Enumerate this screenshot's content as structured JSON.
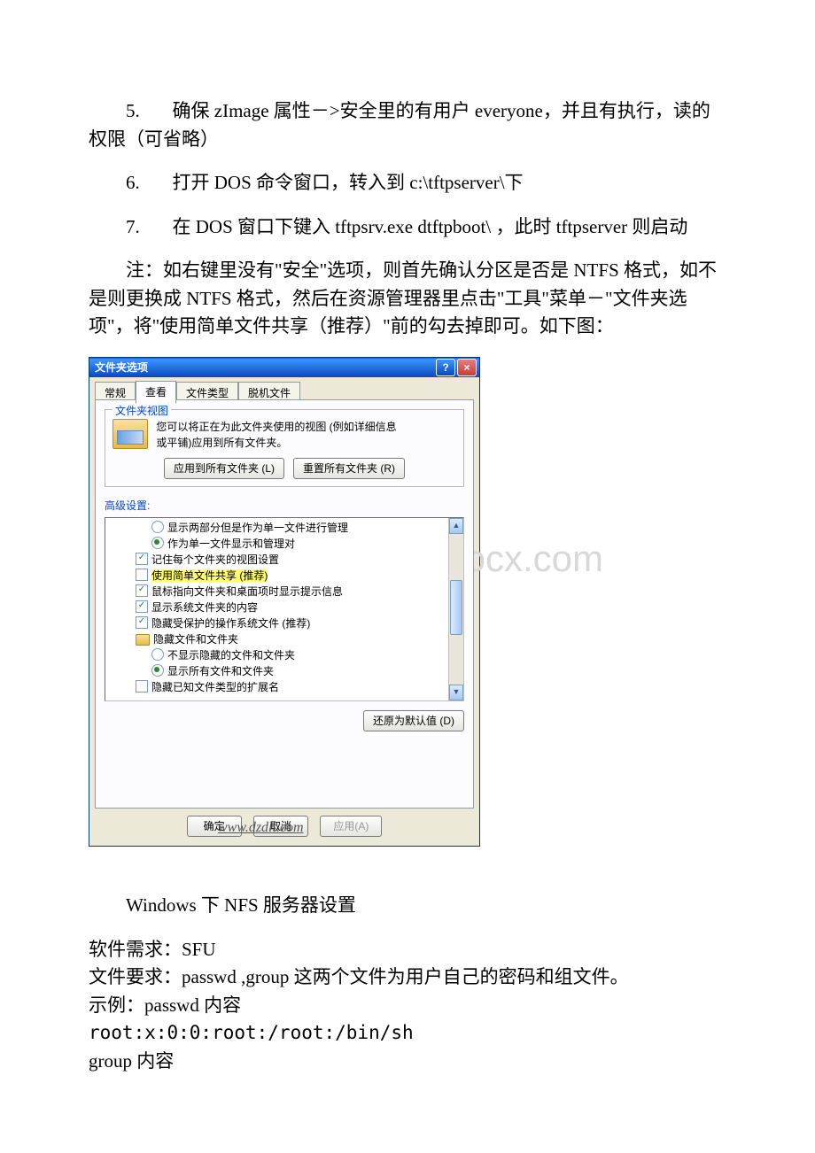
{
  "steps": {
    "s5_num": "5.",
    "s5": "确保 zImage 属性－>安全里的有用户 everyone，并且有执行，读的权限（可省略）",
    "s6_num": "6.",
    "s6": "打开 DOS 命令窗口，转入到 c:\\tftpserver\\下",
    "s7_num": "7.",
    "s7": "在 DOS 窗口下键入 tftpsrv.exe dtftpboot\\ ，此时 tftpserver 则启动"
  },
  "note": "注：如右键里没有\"安全\"选项，则首先确认分区是否是 NTFS 格式，如不是则更换成 NTFS 格式，然后在资源管理器里点击\"工具\"菜单－\"文件夹选项\"，将\"使用简单文件共享（推荐）\"前的勾去掉即可。如下图：",
  "dialog": {
    "title": "文件夹选项",
    "tabs": [
      "常规",
      "查看",
      "文件类型",
      "脱机文件"
    ],
    "groupbox_label": "文件夹视图",
    "view_text": "您可以将正在为此文件夹使用的视图 (例如详细信息或平铺)应用到所有文件夹。",
    "apply_all": "应用到所有文件夹 (L)",
    "reset_all": "重置所有文件夹 (R)",
    "adv_label": "高级设置:",
    "options": {
      "o1": "显示两部分但是作为单一文件进行管理",
      "o2": "作为单一文件显示和管理对",
      "o3": "记住每个文件夹的视图设置",
      "o4": "使用简单文件共享  (推荐)",
      "o5": "鼠标指向文件夹和桌面项时显示提示信息",
      "o6": "显示系统文件夹的内容",
      "o7": "隐藏受保护的操作系统文件 (推荐)",
      "o8": "隐藏文件和文件夹",
      "o9": "不显示隐藏的文件和文件夹",
      "o10": "显示所有文件和文件夹",
      "o11": "隐藏已知文件类型的扩展名"
    },
    "restore_default": "还原为默认值 (D)",
    "ok": "确定",
    "cancel": "取消",
    "apply": "应用(A)",
    "url_wm": "www.dzdlt.com"
  },
  "watermark": ".bdocx.com",
  "footer": {
    "h1": "Windows 下 NFS 服务器设置",
    "l1": "软件需求：SFU",
    "l2": "文件要求：passwd ,group 这两个文件为用户自己的密码和组文件。",
    "l3": "示例：passwd 内容",
    "l4": "root:x:0:0:root:/root:/bin/sh",
    "l5": "group 内容"
  }
}
